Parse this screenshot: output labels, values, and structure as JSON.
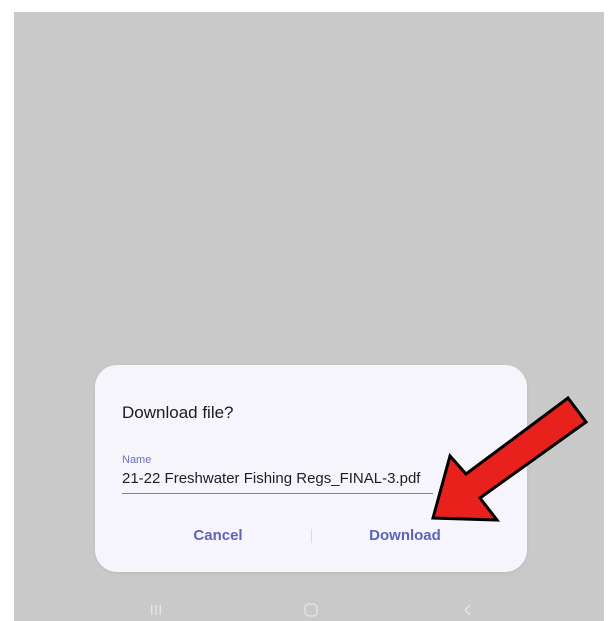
{
  "dialog": {
    "title": "Download file?",
    "name_label": "Name",
    "file_name": "21-22 Freshwater Fishing Regs_FINAL-3.pdf",
    "cancel_label": "Cancel",
    "download_label": "Download"
  },
  "navbar": {
    "recents_icon": "recents-icon",
    "home_icon": "home-icon",
    "back_icon": "back-icon"
  },
  "annotation": {
    "arrow_color": "#e8211c",
    "arrow_outline": "#000000",
    "target": "Download"
  },
  "colors": {
    "backdrop": "#c9c9c9",
    "dialog_bg": "#f6f5fb",
    "accent": "#5c64b8"
  }
}
